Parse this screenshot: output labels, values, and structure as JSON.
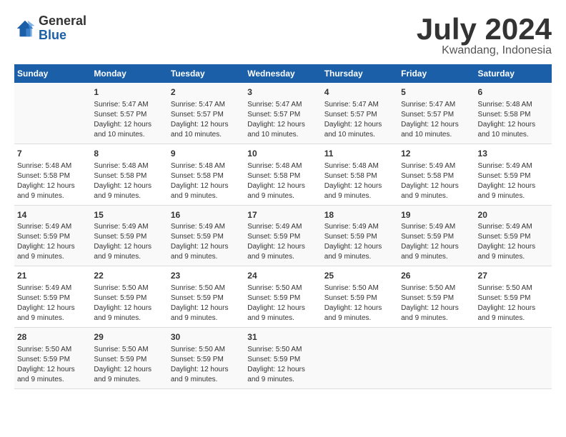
{
  "header": {
    "logo_general": "General",
    "logo_blue": "Blue",
    "month": "July 2024",
    "location": "Kwandang, Indonesia"
  },
  "weekdays": [
    "Sunday",
    "Monday",
    "Tuesday",
    "Wednesday",
    "Thursday",
    "Friday",
    "Saturday"
  ],
  "weeks": [
    [
      {
        "day": "",
        "info": ""
      },
      {
        "day": "1",
        "info": "Sunrise: 5:47 AM\nSunset: 5:57 PM\nDaylight: 12 hours\nand 10 minutes."
      },
      {
        "day": "2",
        "info": "Sunrise: 5:47 AM\nSunset: 5:57 PM\nDaylight: 12 hours\nand 10 minutes."
      },
      {
        "day": "3",
        "info": "Sunrise: 5:47 AM\nSunset: 5:57 PM\nDaylight: 12 hours\nand 10 minutes."
      },
      {
        "day": "4",
        "info": "Sunrise: 5:47 AM\nSunset: 5:57 PM\nDaylight: 12 hours\nand 10 minutes."
      },
      {
        "day": "5",
        "info": "Sunrise: 5:47 AM\nSunset: 5:57 PM\nDaylight: 12 hours\nand 10 minutes."
      },
      {
        "day": "6",
        "info": "Sunrise: 5:48 AM\nSunset: 5:58 PM\nDaylight: 12 hours\nand 10 minutes."
      }
    ],
    [
      {
        "day": "7",
        "info": "Sunrise: 5:48 AM\nSunset: 5:58 PM\nDaylight: 12 hours\nand 9 minutes."
      },
      {
        "day": "8",
        "info": "Sunrise: 5:48 AM\nSunset: 5:58 PM\nDaylight: 12 hours\nand 9 minutes."
      },
      {
        "day": "9",
        "info": "Sunrise: 5:48 AM\nSunset: 5:58 PM\nDaylight: 12 hours\nand 9 minutes."
      },
      {
        "day": "10",
        "info": "Sunrise: 5:48 AM\nSunset: 5:58 PM\nDaylight: 12 hours\nand 9 minutes."
      },
      {
        "day": "11",
        "info": "Sunrise: 5:48 AM\nSunset: 5:58 PM\nDaylight: 12 hours\nand 9 minutes."
      },
      {
        "day": "12",
        "info": "Sunrise: 5:49 AM\nSunset: 5:58 PM\nDaylight: 12 hours\nand 9 minutes."
      },
      {
        "day": "13",
        "info": "Sunrise: 5:49 AM\nSunset: 5:59 PM\nDaylight: 12 hours\nand 9 minutes."
      }
    ],
    [
      {
        "day": "14",
        "info": "Sunrise: 5:49 AM\nSunset: 5:59 PM\nDaylight: 12 hours\nand 9 minutes."
      },
      {
        "day": "15",
        "info": "Sunrise: 5:49 AM\nSunset: 5:59 PM\nDaylight: 12 hours\nand 9 minutes."
      },
      {
        "day": "16",
        "info": "Sunrise: 5:49 AM\nSunset: 5:59 PM\nDaylight: 12 hours\nand 9 minutes."
      },
      {
        "day": "17",
        "info": "Sunrise: 5:49 AM\nSunset: 5:59 PM\nDaylight: 12 hours\nand 9 minutes."
      },
      {
        "day": "18",
        "info": "Sunrise: 5:49 AM\nSunset: 5:59 PM\nDaylight: 12 hours\nand 9 minutes."
      },
      {
        "day": "19",
        "info": "Sunrise: 5:49 AM\nSunset: 5:59 PM\nDaylight: 12 hours\nand 9 minutes."
      },
      {
        "day": "20",
        "info": "Sunrise: 5:49 AM\nSunset: 5:59 PM\nDaylight: 12 hours\nand 9 minutes."
      }
    ],
    [
      {
        "day": "21",
        "info": "Sunrise: 5:49 AM\nSunset: 5:59 PM\nDaylight: 12 hours\nand 9 minutes."
      },
      {
        "day": "22",
        "info": "Sunrise: 5:50 AM\nSunset: 5:59 PM\nDaylight: 12 hours\nand 9 minutes."
      },
      {
        "day": "23",
        "info": "Sunrise: 5:50 AM\nSunset: 5:59 PM\nDaylight: 12 hours\nand 9 minutes."
      },
      {
        "day": "24",
        "info": "Sunrise: 5:50 AM\nSunset: 5:59 PM\nDaylight: 12 hours\nand 9 minutes."
      },
      {
        "day": "25",
        "info": "Sunrise: 5:50 AM\nSunset: 5:59 PM\nDaylight: 12 hours\nand 9 minutes."
      },
      {
        "day": "26",
        "info": "Sunrise: 5:50 AM\nSunset: 5:59 PM\nDaylight: 12 hours\nand 9 minutes."
      },
      {
        "day": "27",
        "info": "Sunrise: 5:50 AM\nSunset: 5:59 PM\nDaylight: 12 hours\nand 9 minutes."
      }
    ],
    [
      {
        "day": "28",
        "info": "Sunrise: 5:50 AM\nSunset: 5:59 PM\nDaylight: 12 hours\nand 9 minutes."
      },
      {
        "day": "29",
        "info": "Sunrise: 5:50 AM\nSunset: 5:59 PM\nDaylight: 12 hours\nand 9 minutes."
      },
      {
        "day": "30",
        "info": "Sunrise: 5:50 AM\nSunset: 5:59 PM\nDaylight: 12 hours\nand 9 minutes."
      },
      {
        "day": "31",
        "info": "Sunrise: 5:50 AM\nSunset: 5:59 PM\nDaylight: 12 hours\nand 9 minutes."
      },
      {
        "day": "",
        "info": ""
      },
      {
        "day": "",
        "info": ""
      },
      {
        "day": "",
        "info": ""
      }
    ]
  ]
}
